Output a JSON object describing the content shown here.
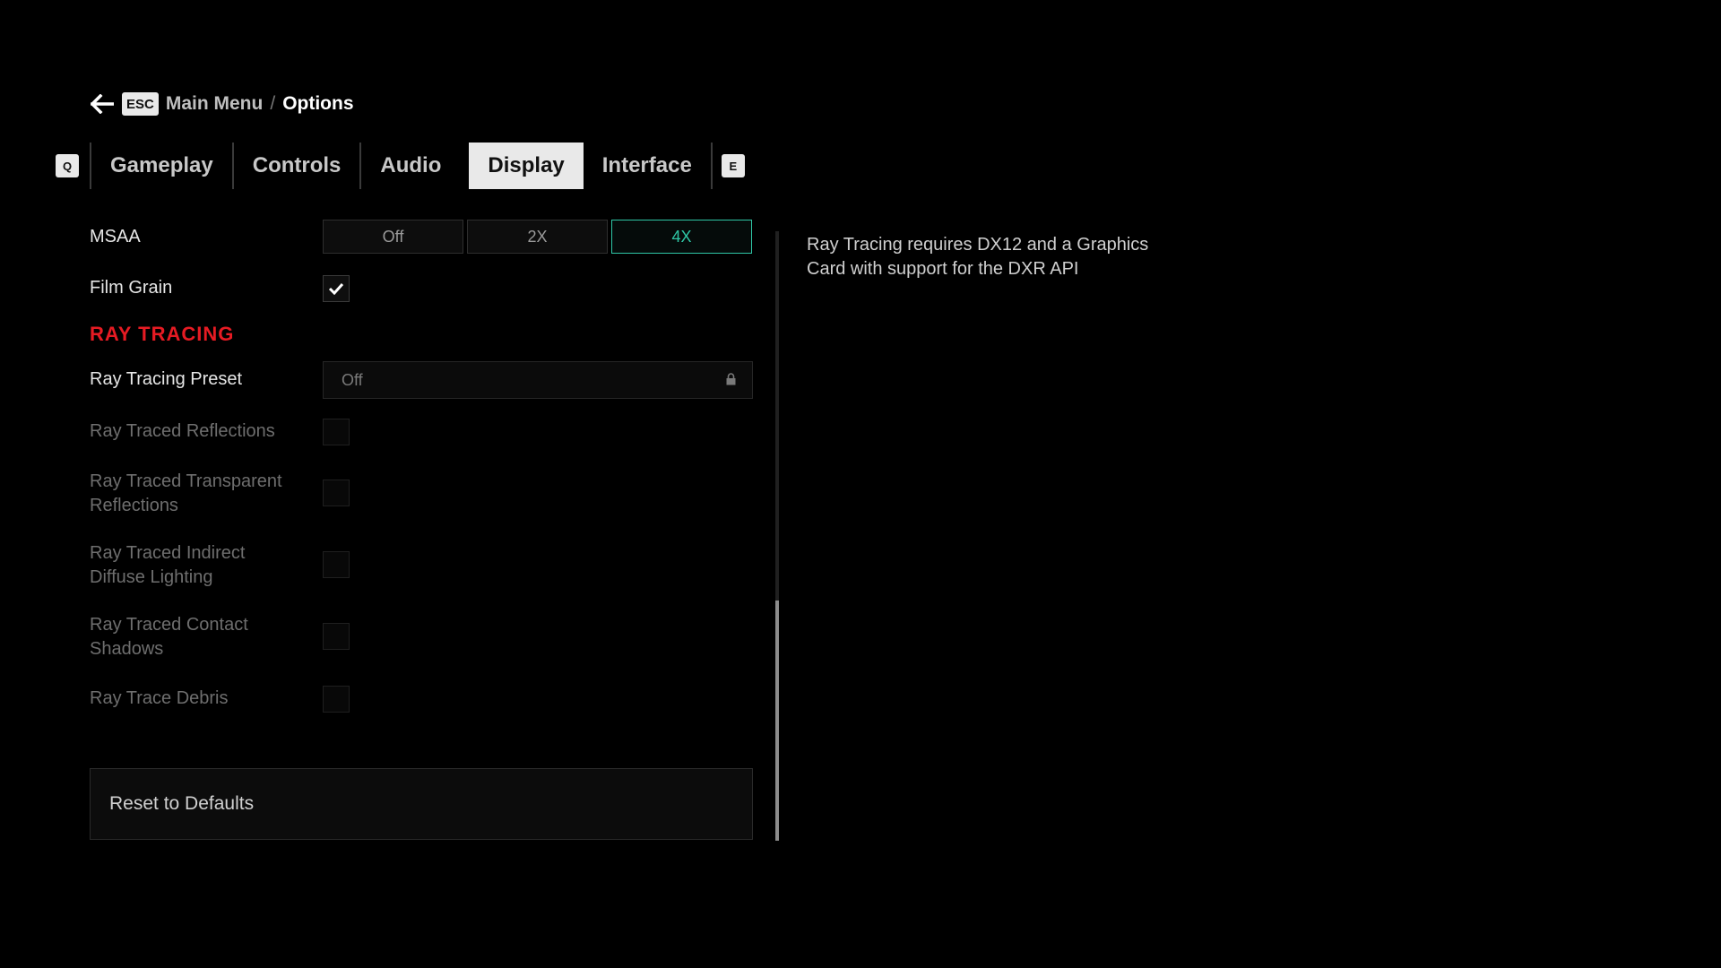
{
  "breadcrumb": {
    "back_key": "ESC",
    "parent": "Main Menu",
    "separator": "/",
    "current": "Options"
  },
  "tabs": {
    "prev_key": "Q",
    "next_key": "E",
    "items": [
      {
        "label": "Gameplay",
        "active": false
      },
      {
        "label": "Controls",
        "active": false
      },
      {
        "label": "Audio",
        "active": false
      },
      {
        "label": "Display",
        "active": true
      },
      {
        "label": "Interface",
        "active": false
      }
    ]
  },
  "settings": {
    "msaa": {
      "label": "MSAA",
      "options": [
        "Off",
        "2X",
        "4X"
      ],
      "selected": "4X"
    },
    "film_grain": {
      "label": "Film Grain",
      "checked": true
    },
    "ray_tracing_section": "RAY TRACING",
    "rt_preset": {
      "label": "Ray Tracing Preset",
      "value": "Off",
      "locked": true
    },
    "rt_reflections": {
      "label": "Ray Traced Reflections",
      "checked": false,
      "disabled": true
    },
    "rt_transparent": {
      "label_line1": "Ray Traced Transparent",
      "label_line2": "Reflections",
      "checked": false,
      "disabled": true
    },
    "rt_indirect": {
      "label_line1": "Ray Traced Indirect",
      "label_line2": "Diffuse Lighting",
      "checked": false,
      "disabled": true
    },
    "rt_contact": {
      "label_line1": "Ray Traced Contact",
      "label_line2": "Shadows",
      "checked": false,
      "disabled": true
    },
    "rt_debris": {
      "label": "Ray Trace Debris",
      "checked": false,
      "disabled": true
    },
    "reset_label": "Reset to Defaults"
  },
  "info_panel": {
    "text": "Ray Tracing requires DX12 and a Graphics Card with support for the DXR API"
  },
  "scrollbar": {
    "position_fraction": 1.0,
    "visible_fraction": 0.39
  },
  "colors": {
    "accent": "#2fc7a6",
    "section_heading": "#e61b23",
    "background": "#000000"
  },
  "icons": {
    "back": "arrow-left-icon",
    "lock": "lock-icon",
    "check": "checkmark-icon"
  }
}
